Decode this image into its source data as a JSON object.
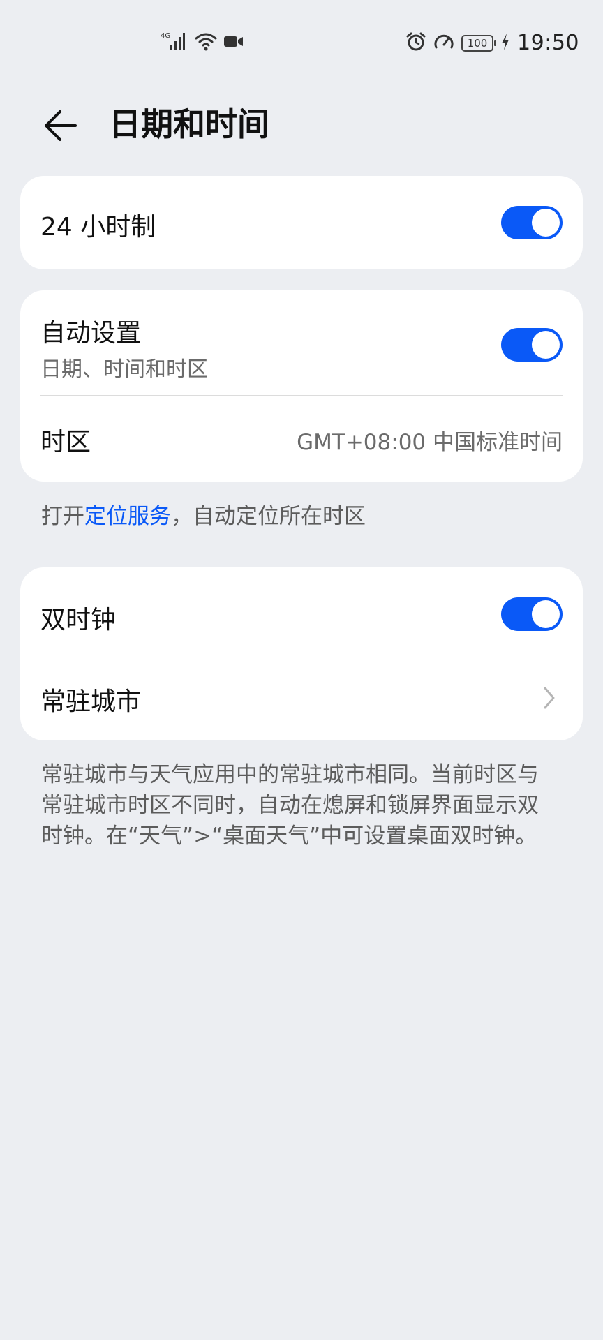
{
  "status_bar": {
    "network_label": "4G",
    "battery_level": "100",
    "time": "19:50",
    "icons": [
      "signal-icon",
      "wifi-icon",
      "video-icon",
      "alarm-icon",
      "speedometer-icon",
      "battery-icon",
      "charging-icon"
    ]
  },
  "header": {
    "title": "日期和时间",
    "back_icon": "back-arrow-icon"
  },
  "hour24": {
    "label": "24 小时制",
    "enabled": true
  },
  "auto_settings": {
    "label": "自动设置",
    "sublabel": "日期、时间和时区",
    "enabled": true,
    "timezone_label": "时区",
    "timezone_value": "GMT+08:00 中国标准时间"
  },
  "location_hint": {
    "prefix": "打开",
    "link": "定位服务",
    "suffix": "，自动定位所在时区"
  },
  "dual_clock": {
    "label": "双时钟",
    "enabled": true,
    "home_city_label": "常驻城市"
  },
  "description": "常驻城市与天气应用中的常驻城市相同。当前时区与常驻城市时区不同时，自动在熄屏和锁屏界面显示双时钟。在“天气”>“桌面天气”中可设置桌面双时钟。",
  "colors": {
    "accent": "#0a59f7",
    "background": "#eceef2",
    "card": "#ffffff"
  }
}
